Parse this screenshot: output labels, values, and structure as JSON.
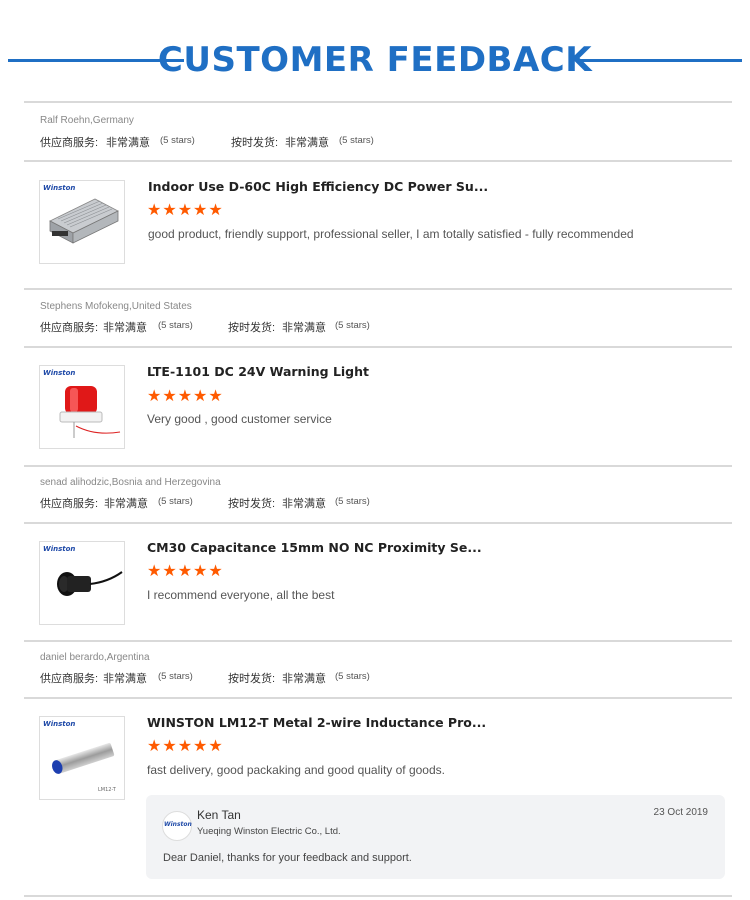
{
  "header": {
    "title": "CUSTOMER FEEDBACK"
  },
  "colors": {
    "accent": "#1f6fc4",
    "stars": "#ff5a00"
  },
  "labels": {
    "supplier_service": "供应商服务:",
    "on_time_delivery": "按时发货:",
    "very_satisfied": "非常满意",
    "stars_text": "(5 stars)",
    "thumb_brand": "Winston"
  },
  "reviews": [
    {
      "buyer": "Ralf Roehn,Germany",
      "supplier_rating": 5,
      "delivery_rating": 5,
      "product_title": "Indoor Use D-60C High Efficiency DC Power Su...",
      "product_rating": 5,
      "comment": "good product, friendly support, professional seller, I am totally satisfied  - fully recommended",
      "thumb_icon": "power-supply-image"
    },
    {
      "buyer": "Stephens Mofokeng,United States",
      "supplier_rating": 5,
      "delivery_rating": 5,
      "product_title": "LTE-1101 DC 24V Warning Light",
      "product_rating": 5,
      "comment": "Very good , good customer service",
      "thumb_icon": "warning-light-image"
    },
    {
      "buyer": "senad alihodzic,Bosnia and Herzegovina",
      "supplier_rating": 5,
      "delivery_rating": 5,
      "product_title": "CM30 Capacitance 15mm NO NC Proximity Se...",
      "product_rating": 5,
      "comment": "I recommend everyone, all the best",
      "thumb_icon": "proximity-sensor-image"
    },
    {
      "buyer": "daniel berardo,Argentina",
      "supplier_rating": 5,
      "delivery_rating": 5,
      "product_title": "WINSTON LM12-T Metal 2-wire Inductance Pro...",
      "product_rating": 5,
      "comment": "fast delivery, good packaking and good quality of goods.",
      "thumb_icon": "inductive-sensor-image",
      "thumb_caption": "LM12-T"
    }
  ],
  "reply": {
    "name": "Ken Tan",
    "company": "Yueqing Winston Electric Co., Ltd.",
    "date": "23 Oct 2019",
    "message": "Dear Daniel, thanks for your feedback and support.",
    "avatar_text": "Winston"
  }
}
